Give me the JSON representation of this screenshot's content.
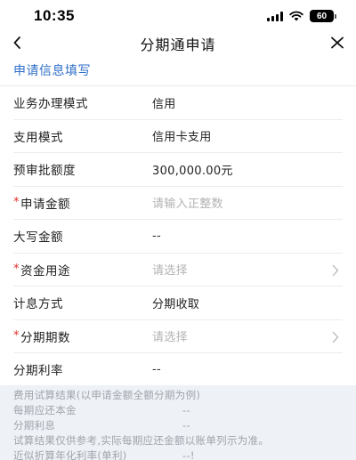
{
  "status": {
    "time": "10:35",
    "battery": "60"
  },
  "nav": {
    "title": "分期通申请",
    "back_icon": "chevron-left-icon",
    "close_icon": "close-icon"
  },
  "section": {
    "title": "申请信息填写"
  },
  "colors": {
    "accent": "#2f6fc9",
    "required": "#e0302a",
    "calc_bg": "#eef1f6"
  },
  "rows": [
    {
      "label": "业务办理模式",
      "value": "信用",
      "required": false
    },
    {
      "label": "支用模式",
      "value": "信用卡支用",
      "required": false
    },
    {
      "label": "预审批额度",
      "value": "300,000.00元",
      "required": false
    },
    {
      "label": "申请金额",
      "placeholder": "请输入正整数",
      "required": true
    },
    {
      "label": "大写金额",
      "value": "--",
      "required": false
    },
    {
      "label": "资金用途",
      "placeholder": "请选择",
      "required": true
    },
    {
      "label": "计息方式",
      "value": "分期收取",
      "required": false
    },
    {
      "label": "分期期数",
      "placeholder": "请选择",
      "required": true
    },
    {
      "label": "分期利率",
      "value": "--",
      "required": false
    }
  ],
  "calc": {
    "title": "费用试算结果(以申请金额全额分期为例)",
    "principal_label": "每期应还本金",
    "principal_value": "--",
    "interest_label": "分期利息",
    "interest_value": "--",
    "note": "试算结果仅供参考,实际每期应还金额以账单列示为准。",
    "apr_label": "近似折算年化利率(单利)",
    "apr_value": "--!"
  }
}
